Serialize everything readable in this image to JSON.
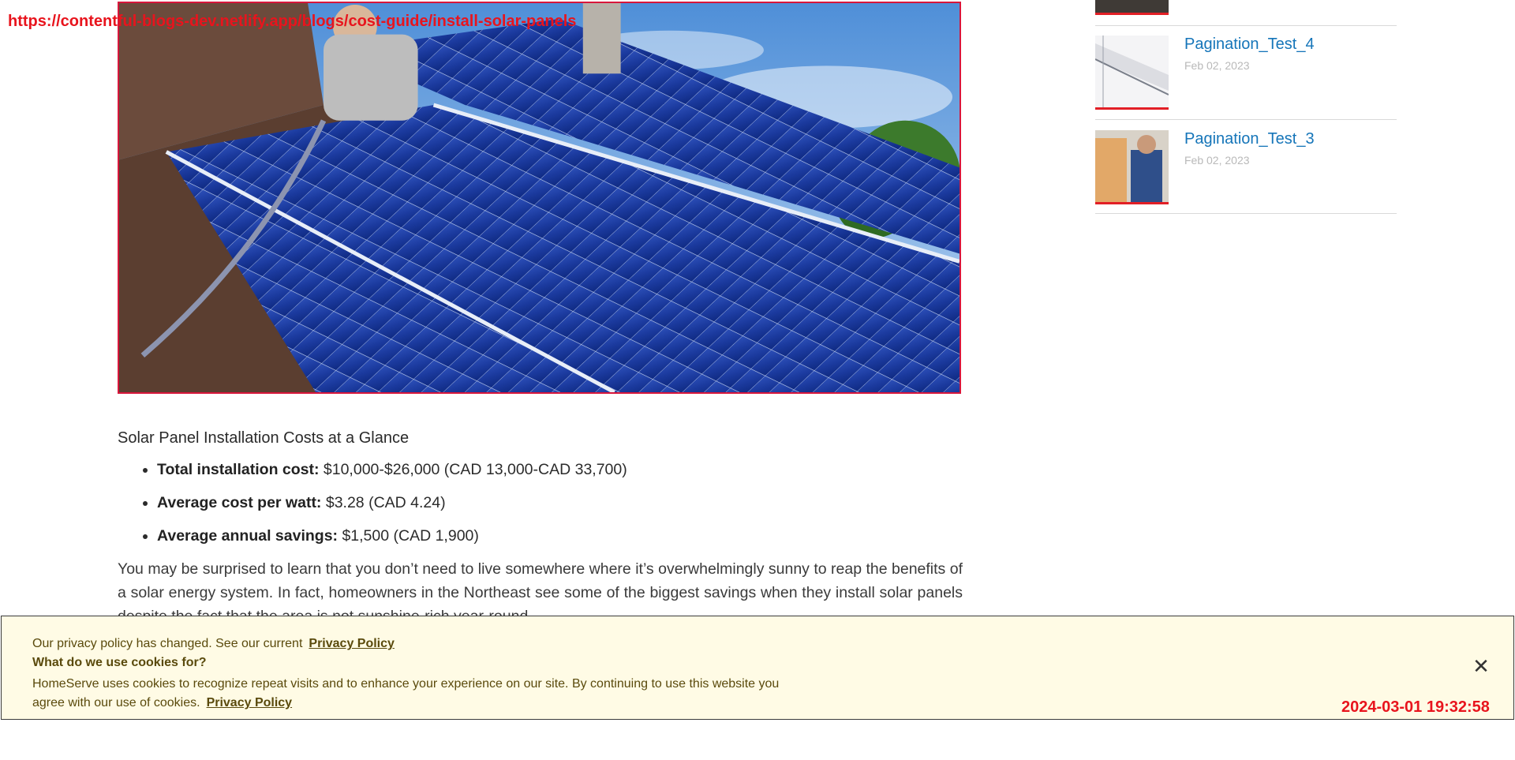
{
  "overlay": {
    "url": "https://contentful-blogs-dev.netlify.app/blogs/cost-guide/install-solar-panels",
    "timestamp": "2024-03-01 19:32:58"
  },
  "article": {
    "heading": "Solar Panel Installation Costs at a Glance",
    "bullets": [
      {
        "label": "Total installation cost:",
        "value": " $10,000-$26,000 (CAD 13,000-CAD 33,700)"
      },
      {
        "label": "Average cost per watt:",
        "value": " $3.28 (CAD 4.24)"
      },
      {
        "label": "Average annual savings:",
        "value": " $1,500 (CAD 1,900)"
      }
    ],
    "paragraph": "You may be surprised to learn that you don’t need to live somewhere where it’s overwhelmingly sunny to reap the benefits of a solar energy system. In fact, homeowners in the Northeast see some of the biggest savings when they install solar panels despite the fact that the area is not sunshine-rich year-round."
  },
  "sidebar": {
    "items": [
      {
        "title": "Pagination_Test_4",
        "date": "Feb 02, 2023"
      },
      {
        "title": "Pagination_Test_3",
        "date": "Feb 02, 2023"
      }
    ]
  },
  "cookie": {
    "line1_text": "Our privacy policy has changed. See our current",
    "privacy_link": "Privacy Policy",
    "heading": "What do we use cookies for?",
    "body": "HomeServe uses cookies to recognize repeat visits and to enhance your experience on our site. By continuing to use this website you agree with our use of cookies.",
    "close_icon": "✕"
  },
  "colors": {
    "accent_red": "#e21f26",
    "link_blue": "#1575b9",
    "cookie_bg": "#fffbe5"
  }
}
